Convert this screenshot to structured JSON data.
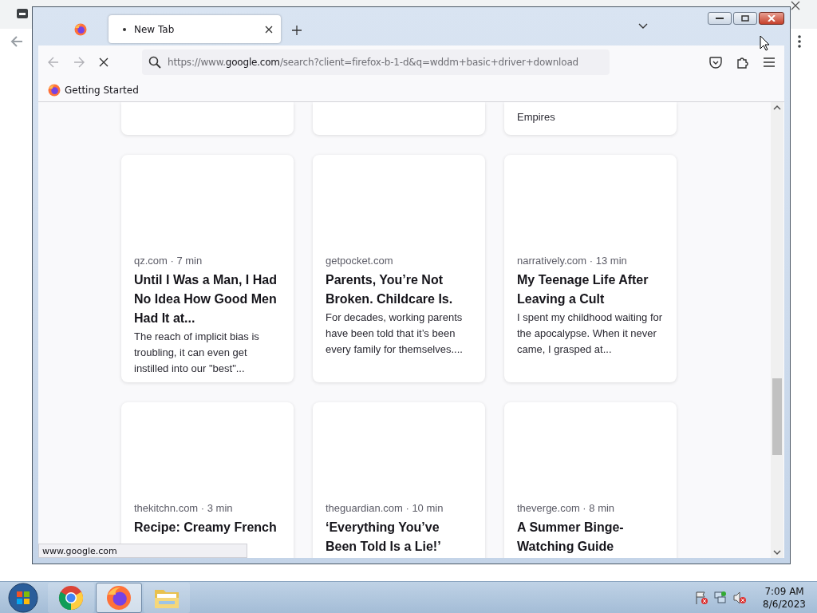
{
  "browser": {
    "tabs": [
      {
        "kind": "pinned",
        "selected": false
      },
      {
        "kind": "tab",
        "label": "New Tab",
        "selected": true
      }
    ],
    "address": "https://www.**google.com**/search?client=firefox-b-1-d&q=wddm+basic+driver+download",
    "bookmarks": [
      {
        "label": "Getting Started"
      }
    ],
    "card_rows": [
      [
        {
          "kind": "cut"
        },
        {
          "kind": "cut"
        },
        {
          "kind": "cut",
          "excerpt": "Empires"
        }
      ],
      [
        {
          "kind": "full",
          "source": "qz.com · 7 min",
          "title": "Until I Was a Man, I Had No Idea How Good Men Had It at...",
          "excerpt": "The reach of implicit bias is troubling, it can even get instilled into our \"best\"..."
        },
        {
          "kind": "full",
          "source": "getpocket.com",
          "title": "Parents, You’re Not Broken. Childcare Is.",
          "excerpt": "For decades, working parents have been told that it’s been every family for themselves...."
        },
        {
          "kind": "full",
          "source": "narratively.com · 13 min",
          "title": "My Teenage Life After Leaving a Cult",
          "excerpt": "I spent my childhood waiting for the apocalypse. When it never came, I grasped at..."
        }
      ],
      [
        {
          "kind": "full",
          "source": "thekitchn.com · 3 min",
          "title": "Recipe: Creamy French"
        },
        {
          "kind": "full",
          "source": "theguardian.com · 10 min",
          "title": "‘Everything You’ve Been Told Is a Lie!’"
        },
        {
          "kind": "full",
          "source": "theverge.com · 8 min",
          "title": "A Summer Binge-Watching Guide"
        }
      ]
    ],
    "status": "www.google.com"
  },
  "taskbar": {
    "apps": [
      {
        "kind": "chrome",
        "selected": false
      },
      {
        "kind": "firefox",
        "selected": true
      },
      {
        "kind": "explorer",
        "selected": false
      }
    ],
    "time": "7:09 AM",
    "date": "8/6/2023"
  }
}
